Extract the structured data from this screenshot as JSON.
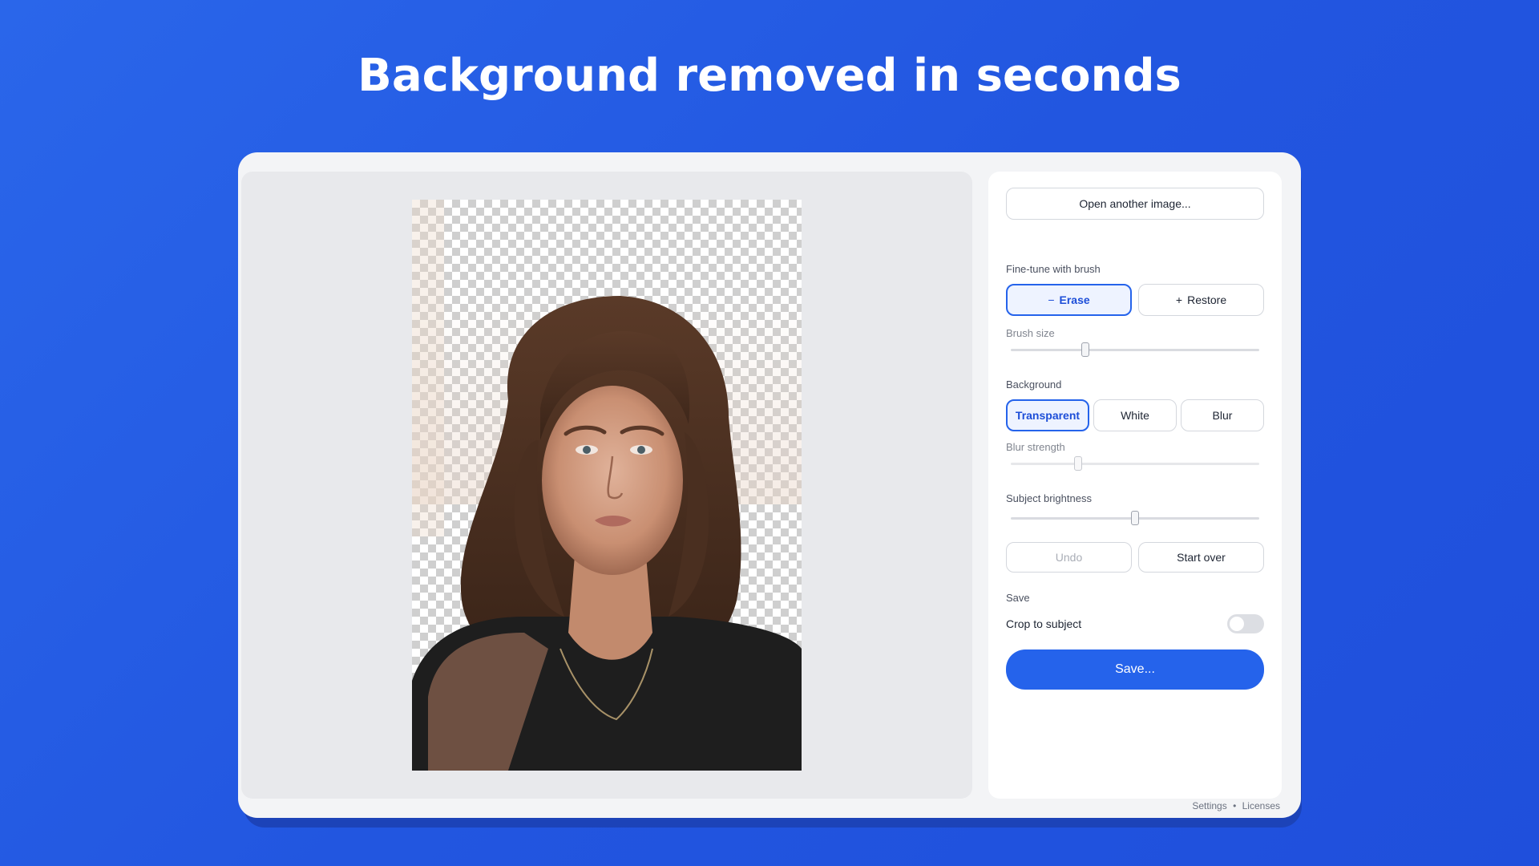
{
  "headline": "Background removed in seconds",
  "panel": {
    "open_button": "Open another image...",
    "finetune_label": "Fine-tune with brush",
    "erase": {
      "icon": "minus-icon",
      "glyph": "−",
      "label": "Erase"
    },
    "restore": {
      "icon": "plus-icon",
      "glyph": "+",
      "label": "Restore"
    },
    "brush_size": {
      "label": "Brush size",
      "value": 0.3
    },
    "background_label": "Background",
    "background_options": [
      "Transparent",
      "White",
      "Blur"
    ],
    "background_selected": "Transparent",
    "blur_strength": {
      "label": "Blur strength",
      "value": 0.27
    },
    "subject_brightness": {
      "label": "Subject brightness",
      "value": 0.5
    },
    "undo": "Undo",
    "start_over": "Start over",
    "save_section_label": "Save",
    "crop_label": "Crop to subject",
    "crop_enabled": false,
    "save_button": "Save..."
  },
  "footer": {
    "settings": "Settings",
    "separator": "•",
    "licenses": "Licenses"
  },
  "colors": {
    "accent": "#2563eb",
    "background_gradient": "#2a66ea",
    "selected_fill": "#eef3ff"
  }
}
